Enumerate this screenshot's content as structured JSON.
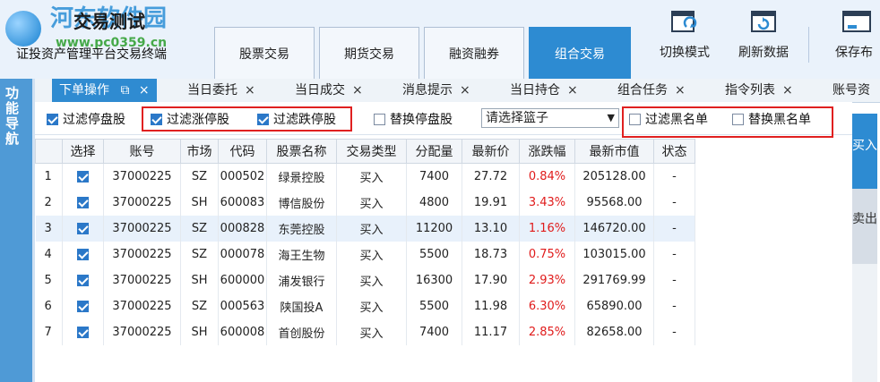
{
  "header": {
    "title": "交易测试",
    "subtitle": "证投资产管理平台交易终端",
    "watermark_text": "河东软件园",
    "watermark_url": "www.pc0359.cn"
  },
  "main_tabs": [
    {
      "label": "股票交易"
    },
    {
      "label": "期货交易"
    },
    {
      "label": "融资融券"
    },
    {
      "label": "组合交易",
      "active": true
    }
  ],
  "toolbar": {
    "switch_mode": "切换模式",
    "refresh": "刷新数据",
    "save": "保存布"
  },
  "leftnav": {
    "label": "功能导航"
  },
  "subtabs": [
    {
      "label": "下单操作",
      "active": true
    },
    {
      "label": "当日委托"
    },
    {
      "label": "当日成交"
    },
    {
      "label": "消息提示"
    },
    {
      "label": "当日持仓"
    },
    {
      "label": "组合任务"
    },
    {
      "label": "指令列表"
    },
    {
      "label": "账号资"
    }
  ],
  "close_glyph": "×",
  "pin_glyph": "⧉",
  "filters": {
    "stop_filter": "过滤停盘股",
    "limit_up_filter": "过滤涨停股",
    "limit_down_filter": "过滤跌停股",
    "replace_stop": "替换停盘股",
    "basket_placeholder": "请选择篮子",
    "blacklist_filter": "过滤黑名单",
    "replace_blacklist": "替换黑名单"
  },
  "table": {
    "headers": [
      "",
      "选择",
      "账号",
      "市场",
      "代码",
      "股票名称",
      "交易类型",
      "分配量",
      "最新价",
      "涨跌幅",
      "最新市值",
      "状态"
    ],
    "rows": [
      [
        "1",
        "",
        "37000225",
        "SZ",
        "000502",
        "绿景控股",
        "买入",
        "7400",
        "27.72",
        "0.84%",
        "205128.00",
        "-"
      ],
      [
        "2",
        "",
        "37000225",
        "SH",
        "600083",
        "博信股份",
        "买入",
        "4800",
        "19.91",
        "3.43%",
        "95568.00",
        "-"
      ],
      [
        "3",
        "",
        "37000225",
        "SZ",
        "000828",
        "东莞控股",
        "买入",
        "11200",
        "13.10",
        "1.16%",
        "146720.00",
        "-"
      ],
      [
        "4",
        "",
        "37000225",
        "SZ",
        "000078",
        "海王生物",
        "买入",
        "5500",
        "18.73",
        "0.75%",
        "103015.00",
        "-"
      ],
      [
        "5",
        "",
        "37000225",
        "SH",
        "600000",
        "浦发银行",
        "买入",
        "16300",
        "17.90",
        "2.93%",
        "291769.99",
        "-"
      ],
      [
        "6",
        "",
        "37000225",
        "SZ",
        "000563",
        "陕国投A",
        "买入",
        "5500",
        "11.98",
        "6.30%",
        "65890.00",
        "-"
      ],
      [
        "7",
        "",
        "37000225",
        "SH",
        "600008",
        "首创股份",
        "买入",
        "7400",
        "11.17",
        "2.85%",
        "82658.00",
        "-"
      ]
    ]
  },
  "side": {
    "buy": "买入",
    "sell": "卖出"
  },
  "colors": {
    "accent": "#2d8bd2",
    "up_red": "#e01b1b",
    "highlight_box": "#e02020"
  }
}
